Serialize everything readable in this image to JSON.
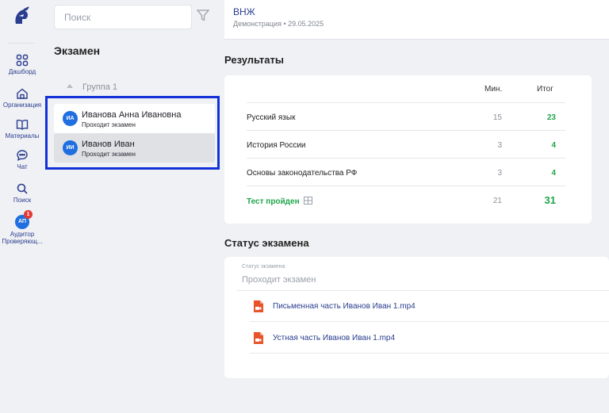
{
  "sidebar": {
    "logo": "spartan-helmet-logo",
    "items": [
      {
        "label": "Дашборд",
        "icon": "dashboard-icon"
      },
      {
        "label": "Организация",
        "icon": "home-icon"
      },
      {
        "label": "Материалы",
        "icon": "book-icon"
      },
      {
        "label": "Чат",
        "icon": "chat-icon"
      },
      {
        "label": "Поиск",
        "icon": "search-icon"
      }
    ],
    "user": {
      "initials": "АП",
      "badge": "1",
      "line1": "Аудитор",
      "line2": "Проверяющ..."
    }
  },
  "list": {
    "search_placeholder": "Поиск",
    "title": "Экзамен",
    "group": "Группа 1",
    "people": [
      {
        "initials": "ИА",
        "name": "Иванова Анна Ивановна",
        "status": "Проходит экзамен"
      },
      {
        "initials": "ИИ",
        "name": "Иванов Иван",
        "status": "Проходит экзамен"
      }
    ]
  },
  "header": {
    "title": "ВНЖ",
    "subtitle": "Демонстрация • 29.05.2025"
  },
  "results": {
    "title": "Результаты",
    "col_min": "Мин.",
    "col_total": "Итог",
    "rows": [
      {
        "subject": "Русский язык",
        "min": "15",
        "total": "23"
      },
      {
        "subject": "История России",
        "min": "3",
        "total": "4"
      },
      {
        "subject": "Основы законодательства РФ",
        "min": "3",
        "total": "4"
      }
    ],
    "summary": {
      "label": "Тест пройден",
      "min": "21",
      "total": "31"
    }
  },
  "exam_status": {
    "title": "Статус экзамена",
    "field_label": "Статус экзамена",
    "field_value": "Проходит экзамен",
    "files": [
      "Письменная часть Иванов Иван 1.mp4",
      "Устная часть Иванов Иван 1.mp4"
    ]
  },
  "colors": {
    "accent": "#2a3d8f",
    "success": "#1fa64b",
    "selection": "#1231d8",
    "avatar": "#1f6fe0",
    "file_icon": "#e8542a"
  }
}
